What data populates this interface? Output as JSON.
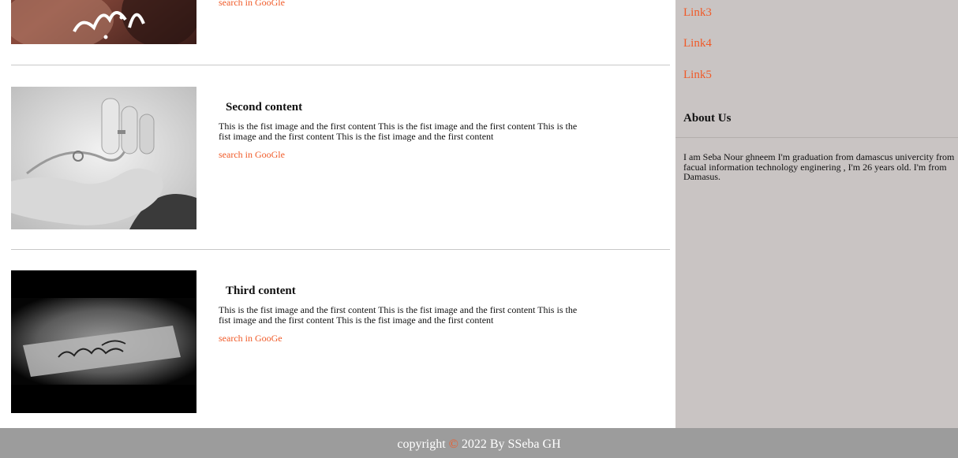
{
  "articles": [
    {
      "link": "search in GooGle",
      "image": "arabic-calligraphy-photo"
    },
    {
      "title": "Second content",
      "body": "This is the fist image and the first content This is the fist image and the first content This is the fist image and the first content This is the fist image and the first content",
      "link": "search in GooGle",
      "image": "pinky-promise-hands-photo"
    },
    {
      "title": "Third content",
      "body": "This is the fist image and the first content This is the fist image and the first content This is the fist image and the first content This is the fist image and the first content",
      "link": "search in GooGe",
      "image": "arabic-text-on-paper-photo"
    }
  ],
  "sidebar": {
    "links": [
      "Link3",
      "Link4",
      "Link5"
    ],
    "about": {
      "title": "About Us",
      "text": "I am Seba Nour ghneem I'm graduation from damascus univercity from facual information technology enginering , I'm 26 years old. I'm from Damasus."
    }
  },
  "footer": {
    "prefix": "copyright",
    "symbol": "©",
    "suffix": "2022 By SSeba GH"
  },
  "colors": {
    "accent": "#f05a28",
    "sidebar_bg": "#c9c4c3",
    "footer_bg": "#9c9c9c"
  }
}
